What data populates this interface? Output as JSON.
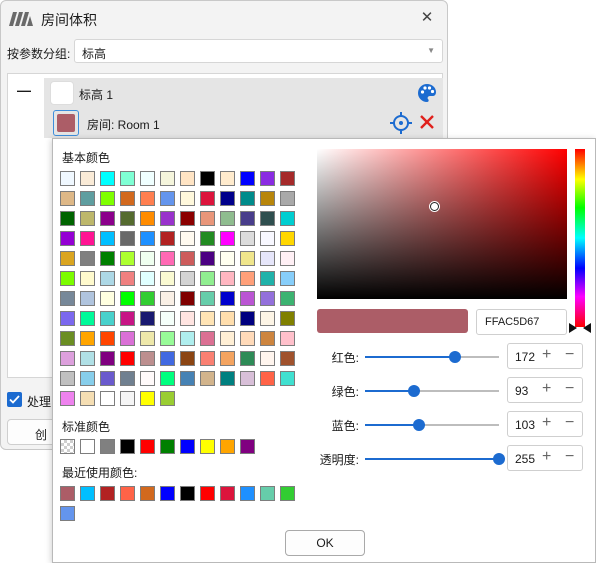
{
  "window": {
    "title": "房间体积",
    "group_label": "按参数分组:",
    "group_value": "标高",
    "level_label": "标高 1",
    "room_label": "房间: Room 1",
    "process_label": "处理",
    "create_label": "创"
  },
  "picker": {
    "basic_title": "基本颜色",
    "standard_title": "标准颜色",
    "recent_title": "最近使用颜色:",
    "hex_value": "FFAC5D67",
    "preview_color": "#ac5d67",
    "ok_label": "OK",
    "channels": [
      {
        "label": "红色:",
        "value": "172",
        "fraction": 0.675
      },
      {
        "label": "绿色:",
        "value": "93",
        "fraction": 0.365
      },
      {
        "label": "蓝色:",
        "value": "103",
        "fraction": 0.404
      },
      {
        "label": "透明度:",
        "value": "255",
        "fraction": 1.0
      }
    ],
    "basic_colors": [
      [
        "#f0f8ff",
        "#faebd7",
        "#00ffff",
        "#7fffd4",
        "#f0ffff",
        "#f5f5dc",
        "#ffe4c4",
        "#000000",
        "#ffebcd",
        "#0000ff",
        "#8a2be2",
        "#a52a2a"
      ],
      [
        "#deb887",
        "#5f9ea0",
        "#7fff00",
        "#d2691e",
        "#ff7f50",
        "#6495ed",
        "#fff8dc",
        "#dc143c",
        "#00008b",
        "#008b8b",
        "#b8860b",
        "#a9a9a9"
      ],
      [
        "#006400",
        "#bdb76b",
        "#8b008b",
        "#556b2f",
        "#ff8c00",
        "#9932cc",
        "#8b0000",
        "#e9967a",
        "#8fbc8f",
        "#483d8b",
        "#2f4f4f",
        "#00ced1"
      ],
      [
        "#9400d3",
        "#ff1493",
        "#00bfff",
        "#696969",
        "#1e90ff",
        "#b22222",
        "#fffaf0",
        "#228b22",
        "#ff00ff",
        "#dcdcdc",
        "#f8f8ff",
        "#ffd700"
      ],
      [
        "#daa520",
        "#808080",
        "#008000",
        "#adff2f",
        "#f0fff0",
        "#ff69b4",
        "#cd5c5c",
        "#4b0082",
        "#fffff0",
        "#f0e68c",
        "#e6e6fa",
        "#fff0f5"
      ],
      [
        "#7cfc00",
        "#fffacd",
        "#add8e6",
        "#f08080",
        "#e0ffff",
        "#fafad2",
        "#d3d3d3",
        "#90ee90",
        "#ffb6c1",
        "#ffa07a",
        "#20b2aa",
        "#87cefa"
      ],
      [
        "#778899",
        "#b0c4de",
        "#ffffe0",
        "#00ff00",
        "#32cd32",
        "#faf0e6",
        "#800000",
        "#66cdaa",
        "#0000cd",
        "#ba55d3",
        "#9370db",
        "#3cb371"
      ],
      [
        "#7b68ee",
        "#00fa9a",
        "#48d1cc",
        "#c71585",
        "#191970",
        "#f5fffa",
        "#ffe4e1",
        "#ffe4b5",
        "#ffdead",
        "#000080",
        "#fdf5e6",
        "#808000"
      ],
      [
        "#6b8e23",
        "#ffa500",
        "#ff4500",
        "#da70d6",
        "#eee8aa",
        "#98fb98",
        "#afeeee",
        "#db7093",
        "#ffefd5",
        "#ffdab9",
        "#cd853f",
        "#ffc0cb"
      ],
      [
        "#dda0dd",
        "#b0e0e6",
        "#800080",
        "#ff0000",
        "#bc8f8f",
        "#4169e1",
        "#8b4513",
        "#fa8072",
        "#f4a460",
        "#2e8b57",
        "#fff5ee",
        "#a0522d"
      ],
      [
        "#c0c0c0",
        "#87ceeb",
        "#6a5acd",
        "#708090",
        "#fffafa",
        "#00ff7f",
        "#4682b4",
        "#d2b48c",
        "#008080",
        "#d8bfd8",
        "#ff6347",
        "#40e0d0"
      ],
      [
        "#ee82ee",
        "#f5deb3",
        "#ffffff",
        "#f5f5f5",
        "#ffff00",
        "#9acd32"
      ]
    ],
    "standard_colors": [
      "transparent",
      "#ffffff",
      "#808080",
      "#000000",
      "#ff0000",
      "#008000",
      "#0000ff",
      "#ffff00",
      "#ffa500",
      "#800080"
    ],
    "recent_colors": [
      "#ac5d67",
      "#00bfff",
      "#b22222",
      "#ff6347",
      "#d2691e",
      "#0000ff",
      "#000000",
      "#ff0000",
      "#dc143c",
      "#1e90ff",
      "#66cdaa",
      "#32cd32",
      "#6495ed"
    ]
  }
}
